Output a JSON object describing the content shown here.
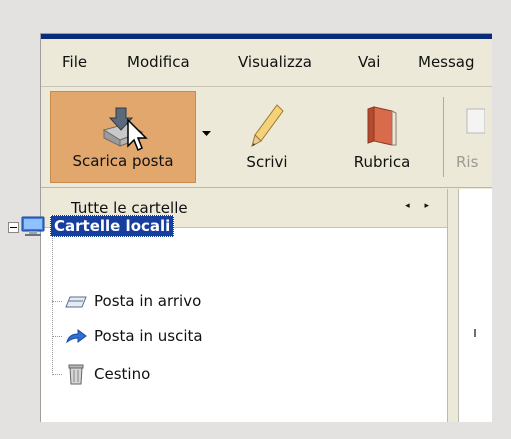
{
  "menu": {
    "file": "File",
    "modifica": "Modifica",
    "visualizza": "Visualizza",
    "vai": "Vai",
    "messaggi": "Messag"
  },
  "toolbar": {
    "scarica": "Scarica posta",
    "scrivi": "Scrivi",
    "rubrica": "Rubrica",
    "rispondi": "Ris"
  },
  "folder_pane": {
    "title": "Tutte le cartelle",
    "arrows": "◂ ▸",
    "root": "Cartelle locali",
    "folders": [
      "Posta in arrivo",
      "Posta in uscita",
      "Cestino"
    ]
  },
  "colors": {
    "selection": "#163e9f",
    "hover_button": "#e1a76d",
    "window_face": "#ece9d8"
  }
}
